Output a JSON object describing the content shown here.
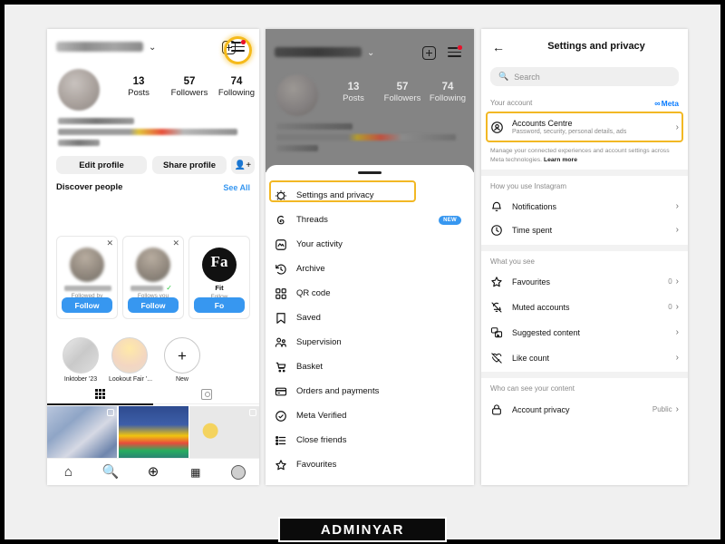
{
  "watermark": {
    "text": "ADMINYAR"
  },
  "left_panel": {
    "name": "instagram-profile",
    "chevron": "⌄",
    "stats": [
      {
        "num": "13",
        "label": "Posts"
      },
      {
        "num": "57",
        "label": "Followers"
      },
      {
        "num": "74",
        "label": "Following"
      }
    ],
    "buttons": {
      "edit_profile": "Edit profile",
      "share_profile": "Share profile"
    },
    "discover": {
      "title": "Discover people",
      "see_all": "See All",
      "cards": [
        {
          "sub": "Followed by",
          "follow": "Follow"
        },
        {
          "sub": "Follows you",
          "follow": "Follow"
        },
        {
          "sub": "Follow",
          "follow": "Fo",
          "initials": "Fa",
          "title": "Fit"
        }
      ]
    },
    "highlights": [
      {
        "caption": "Inktober '23"
      },
      {
        "caption": "Lookout Fair '..."
      },
      {
        "caption": "New"
      }
    ]
  },
  "middle_panel": {
    "chevron": "⌄",
    "stats": [
      {
        "num": "13",
        "label": "Posts"
      },
      {
        "num": "57",
        "label": "Followers"
      },
      {
        "num": "74",
        "label": "Following"
      }
    ],
    "menu": [
      {
        "label": "Settings and privacy",
        "icon": "gear-icon",
        "badge": ""
      },
      {
        "label": "Threads",
        "icon": "threads-icon",
        "badge": "NEW"
      },
      {
        "label": "Your activity",
        "icon": "activity-icon",
        "badge": ""
      },
      {
        "label": "Archive",
        "icon": "archive-clock-icon",
        "badge": ""
      },
      {
        "label": "QR code",
        "icon": "qr-code-icon",
        "badge": ""
      },
      {
        "label": "Saved",
        "icon": "bookmark-icon",
        "badge": ""
      },
      {
        "label": "Supervision",
        "icon": "supervision-icon",
        "badge": ""
      },
      {
        "label": "Basket",
        "icon": "basket-icon",
        "badge": ""
      },
      {
        "label": "Orders and payments",
        "icon": "card-icon",
        "badge": ""
      },
      {
        "label": "Meta Verified",
        "icon": "verified-icon",
        "badge": ""
      },
      {
        "label": "Close friends",
        "icon": "list-icon",
        "badge": ""
      },
      {
        "label": "Favourites",
        "icon": "star-icon",
        "badge": ""
      }
    ]
  },
  "right_panel": {
    "title": "Settings and privacy",
    "back_icon": "arrow-left-icon",
    "search": {
      "placeholder": "Search",
      "icon": "search-icon"
    },
    "sections": [
      {
        "title": "Your account",
        "meta_label": "Meta",
        "rows": [
          {
            "label": "Accounts Centre",
            "sub": "Password, security, personal details, ads",
            "value": "",
            "icon": "accounts-centre-icon",
            "chevron": "›"
          }
        ],
        "note_text": "Manage your connected experiences and account settings across Meta technologies. ",
        "note_link": "Learn more"
      },
      {
        "title": "How you use Instagram",
        "rows": [
          {
            "label": "Notifications",
            "sub": "",
            "value": "",
            "icon": "bell-icon",
            "chevron": "›"
          },
          {
            "label": "Time spent",
            "sub": "",
            "value": "",
            "icon": "clock-icon",
            "chevron": "›"
          }
        ]
      },
      {
        "title": "What you see",
        "rows": [
          {
            "label": "Favourites",
            "sub": "",
            "value": "0",
            "icon": "star-icon",
            "chevron": "›"
          },
          {
            "label": "Muted accounts",
            "sub": "",
            "value": "0",
            "icon": "muted-icon",
            "chevron": "›"
          },
          {
            "label": "Suggested content",
            "sub": "",
            "value": "",
            "icon": "suggested-content-icon",
            "chevron": "›"
          },
          {
            "label": "Like count",
            "sub": "",
            "value": "",
            "icon": "like-count-hidden-icon",
            "chevron": "›"
          }
        ]
      },
      {
        "title": "Who can see your content",
        "rows": [
          {
            "label": "Account privacy",
            "sub": "",
            "value": "Public",
            "icon": "lock-icon",
            "chevron": "›"
          }
        ]
      }
    ]
  },
  "colors": {
    "highlight": "#f2b824",
    "instagram_blue": "#3797f0",
    "meta_blue": "#0a7cff",
    "notification_red": "#e8122b"
  }
}
